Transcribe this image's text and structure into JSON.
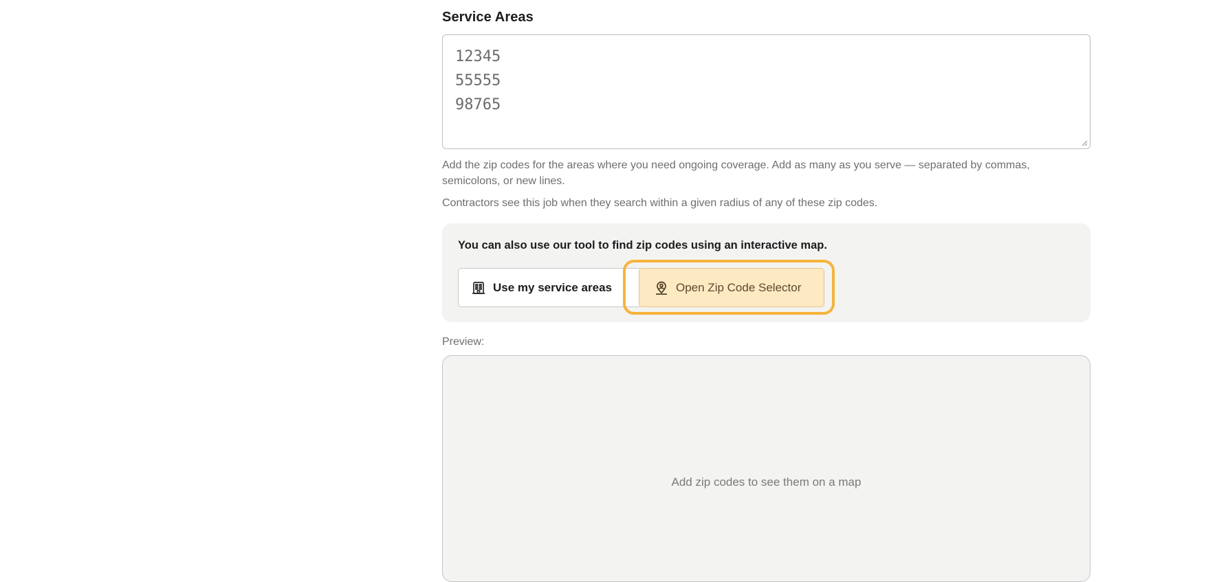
{
  "service_areas": {
    "title": "Service Areas",
    "zip_codes_value": "12345\n55555\n98765",
    "help_text": "Add the zip codes for the areas where you need ongoing coverage. Add as many as you serve — separated by commas, semicolons, or new lines.",
    "help_text_2": "Contractors see this job when they search within a given radius of any of these zip codes."
  },
  "tool_panel": {
    "intro": "You can also use our tool to find zip codes using an interactive map.",
    "use_service_areas_label": "Use my service areas",
    "use_service_areas_icon": "building-icon",
    "open_selector_label": "Open Zip Code Selector",
    "open_selector_icon": "map-pin-person-icon",
    "highlight_color": "#f6b43a"
  },
  "preview": {
    "label": "Preview:",
    "empty_message": "Add zip codes to see them on a map"
  }
}
